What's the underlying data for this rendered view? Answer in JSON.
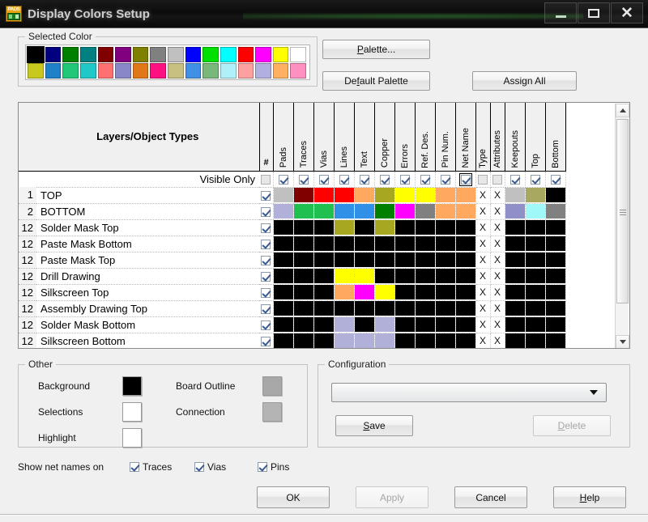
{
  "window": {
    "title": "Display Colors Setup",
    "app_icon": "pads-icon",
    "minimize": "minimize-icon",
    "maximize": "maximize-icon",
    "close": "close-icon"
  },
  "selected_color": {
    "legend": "Selected Color",
    "selected_index": 0,
    "palette_row1": [
      "#000000",
      "#000080",
      "#008000",
      "#008080",
      "#800000",
      "#800080",
      "#808000",
      "#808080",
      "#c0c0c0",
      "#0000ff",
      "#00e000",
      "#00ffff",
      "#ff0000",
      "#ff00ff",
      "#ffff00",
      "#ffffff"
    ],
    "palette_row2": [
      "#c8c81e",
      "#2080c8",
      "#20c878",
      "#20c8c8",
      "#ff7070",
      "#8888c8",
      "#e07818",
      "#ff1080",
      "#c8c080",
      "#4090e8",
      "#78b878",
      "#b0f0f8",
      "#ffa0a0",
      "#b0b0e0",
      "#ffb060",
      "#ff90c0"
    ]
  },
  "buttons": {
    "palette": "Palette...",
    "palette_accel": "P",
    "default_palette": "Default Palette",
    "default_palette_accel": "f",
    "assign_all": "Assign All"
  },
  "table": {
    "layers_header": "Layers/Object Types",
    "columns": [
      "#",
      "Pads",
      "Traces",
      "Vias",
      "Lines",
      "Text",
      "Copper",
      "Errors",
      "Ref. Des.",
      "Pin Num.",
      "Net Name",
      "Type",
      "Attributes",
      "Keepouts",
      "Top",
      "Bottom"
    ],
    "visible_only_label": "Visible Only",
    "visible_only_checks": [
      false,
      true,
      true,
      true,
      true,
      true,
      true,
      true,
      true,
      true,
      true,
      false,
      false,
      true,
      true,
      true
    ],
    "visible_only_focus_index": 10,
    "rows": [
      {
        "num": "1",
        "name": "TOP",
        "checked": true,
        "cells": [
          "#c0c0c0",
          "#800000",
          "#ff0000",
          "#ff0000",
          "#ffa860",
          "#a8a820",
          "#ffff00",
          "#ffff00",
          "#ffa860",
          "#ffa860",
          "X",
          "X",
          "#c0c0c0",
          "#a8a860",
          "#000000"
        ]
      },
      {
        "num": "2",
        "name": "BOTTOM",
        "checked": true,
        "cells": [
          "#b0b0d8",
          "#20c050",
          "#20c050",
          "#3090e8",
          "#3090e8",
          "#008000",
          "#ff00ff",
          "#808080",
          "#ffa860",
          "#ffa860",
          "X",
          "X",
          "#9090c8",
          "#a0f8f8",
          "#808080"
        ]
      },
      {
        "num": "12",
        "name": "Solder Mask Top",
        "checked": true,
        "cells": [
          "#000000",
          "#000000",
          "#000000",
          "#a8a820",
          "#000000",
          "#a8a820",
          "#000000",
          "#000000",
          "#000000",
          "#000000",
          "X",
          "X",
          "#000000",
          "#000000",
          "#000000"
        ]
      },
      {
        "num": "12",
        "name": "Paste Mask Bottom",
        "checked": true,
        "cells": [
          "#000000",
          "#000000",
          "#000000",
          "#000000",
          "#000000",
          "#000000",
          "#000000",
          "#000000",
          "#000000",
          "#000000",
          "X",
          "X",
          "#000000",
          "#000000",
          "#000000"
        ]
      },
      {
        "num": "12",
        "name": "Paste Mask Top",
        "checked": true,
        "cells": [
          "#000000",
          "#000000",
          "#000000",
          "#000000",
          "#000000",
          "#000000",
          "#000000",
          "#000000",
          "#000000",
          "#000000",
          "X",
          "X",
          "#000000",
          "#000000",
          "#000000"
        ]
      },
      {
        "num": "12",
        "name": "Drill Drawing",
        "checked": true,
        "cells": [
          "#000000",
          "#000000",
          "#000000",
          "#ffff00",
          "#ffff00",
          "#000000",
          "#000000",
          "#000000",
          "#000000",
          "#000000",
          "X",
          "X",
          "#000000",
          "#000000",
          "#000000"
        ]
      },
      {
        "num": "12",
        "name": "Silkscreen Top",
        "checked": true,
        "cells": [
          "#000000",
          "#000000",
          "#000000",
          "#ffa860",
          "#ff00ff",
          "#ffff00",
          "#000000",
          "#000000",
          "#000000",
          "#000000",
          "X",
          "X",
          "#000000",
          "#000000",
          "#000000"
        ]
      },
      {
        "num": "12",
        "name": "Assembly Drawing Top",
        "checked": true,
        "cells": [
          "#000000",
          "#000000",
          "#000000",
          "#000000",
          "#000000",
          "#000000",
          "#000000",
          "#000000",
          "#000000",
          "#000000",
          "X",
          "X",
          "#000000",
          "#000000",
          "#000000"
        ]
      },
      {
        "num": "12",
        "name": "Solder Mask Bottom",
        "checked": true,
        "cells": [
          "#000000",
          "#000000",
          "#000000",
          "#b0b0d8",
          "#000000",
          "#b0b0d8",
          "#000000",
          "#000000",
          "#000000",
          "#000000",
          "X",
          "X",
          "#000000",
          "#000000",
          "#000000"
        ]
      },
      {
        "num": "12",
        "name": "Silkscreen Bottom",
        "checked": true,
        "cells": [
          "#000000",
          "#000000",
          "#000000",
          "#b0b0d8",
          "#b0b0d8",
          "#b0b0d8",
          "#000000",
          "#000000",
          "#000000",
          "#000000",
          "X",
          "X",
          "#000000",
          "#000000",
          "#000000"
        ]
      }
    ]
  },
  "other": {
    "legend": "Other",
    "items": [
      {
        "label": "Background",
        "color": "#000000"
      },
      {
        "label": "Selections",
        "color": "#ffffff"
      },
      {
        "label": "Highlight",
        "color": "#ffffff"
      },
      {
        "label": "Board Outline",
        "color": "#a8a8a8"
      },
      {
        "label": "Connection",
        "color": "#b4b4b4"
      }
    ]
  },
  "configuration": {
    "legend": "Configuration",
    "selected_value": "",
    "save_label": "Save",
    "save_accel": "S",
    "delete_label": "Delete",
    "delete_accel": "D",
    "delete_enabled": false
  },
  "footer": {
    "show_net_names_label": "Show net names on",
    "checks": [
      {
        "label": "Traces",
        "checked": true
      },
      {
        "label": "Vias",
        "checked": true
      },
      {
        "label": "Pins",
        "checked": true
      }
    ],
    "ok": "OK",
    "apply": "Apply",
    "apply_enabled": false,
    "cancel": "Cancel",
    "help": "Help",
    "help_accel": "H"
  }
}
